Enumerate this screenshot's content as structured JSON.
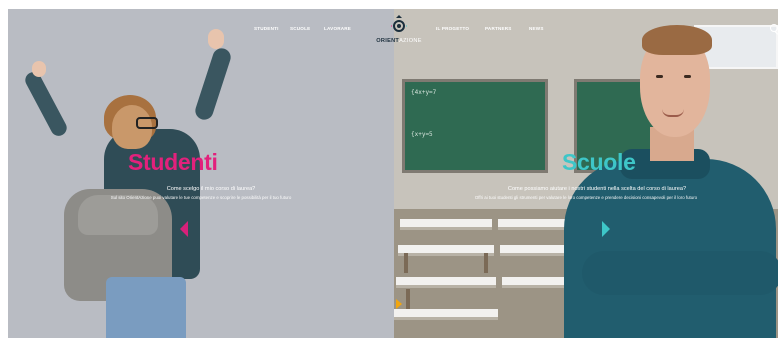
{
  "nav": {
    "left_items": [
      "STUDENTI",
      "SCUOLE",
      "LAVORARE"
    ],
    "right_items": [
      "IL PROGETTO",
      "PARTNERS",
      "NEWS"
    ]
  },
  "logo": {
    "brand_bold": "ORIENT",
    "brand_light": "AZIONE"
  },
  "students": {
    "title": "Studenti",
    "question": "Come scelgo il mio corso di laurea?",
    "subtitle": "Sul sito OrientAzione puoi valutare le tue competenze e scoprire le possibilità per il tuo futuro",
    "accent": "#e2217c"
  },
  "schools": {
    "title": "Scuole",
    "question": "Come possiamo aiutare i nostri studenti nella scelta del corso di laurea?",
    "subtitle": "Offri ai tuoi studenti gli strumenti per valutare le loro competenze e prendere decisioni consapevoli per il loro futuro",
    "accent": "#3ec6c8"
  },
  "icons": [
    "search-icon",
    "arrow-left-icon",
    "arrow-right-icon",
    "logo-mark-icon"
  ]
}
